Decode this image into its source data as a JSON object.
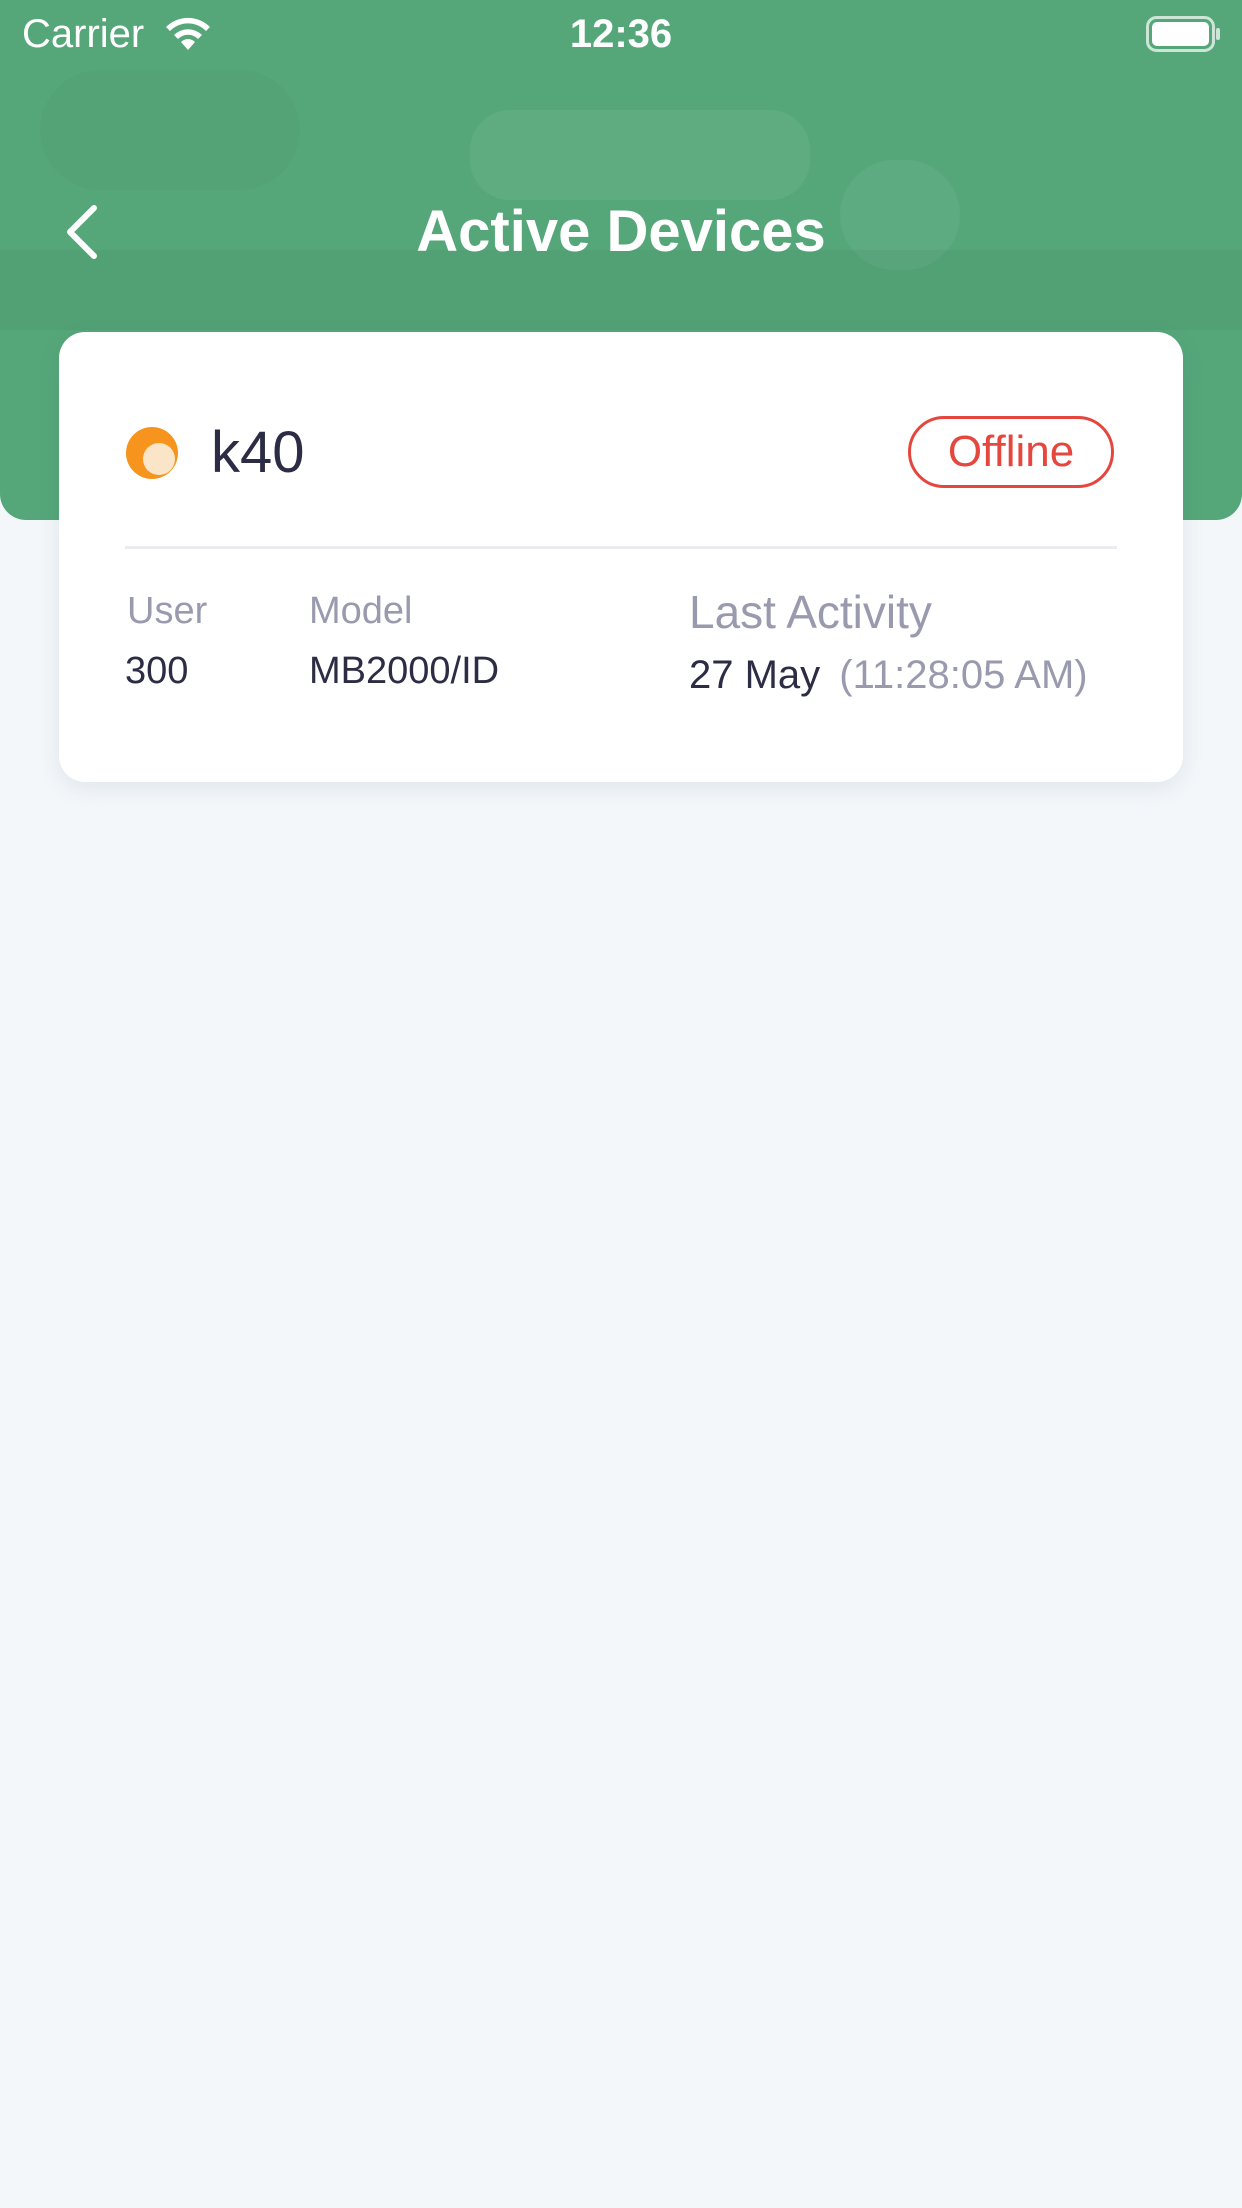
{
  "status_bar": {
    "carrier": "Carrier",
    "time": "12:36",
    "wifi_icon": "wifi-icon",
    "battery_icon": "battery-icon"
  },
  "header": {
    "title": "Active Devices",
    "back_icon": "chevron-left-icon",
    "background_color": "#55a77a"
  },
  "device": {
    "name": "k40",
    "status_icon": "status-dot-icon",
    "status_icon_color": "#f7941d",
    "status": "Offline",
    "status_color": "#e5473f",
    "user_label": "User",
    "user_value": "300",
    "model_label": "Model",
    "model_value": "MB2000/ID",
    "last_activity_label": "Last Activity",
    "last_activity_date": "27 May",
    "last_activity_time": "(11:28:05 AM)"
  }
}
